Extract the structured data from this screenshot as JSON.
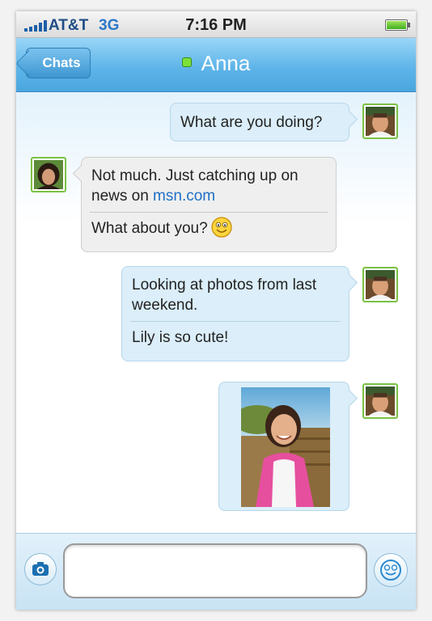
{
  "status_bar": {
    "carrier": "AT&T",
    "network": "3G",
    "time": "7:16 PM"
  },
  "nav": {
    "back_label": "Chats",
    "contact_name": "Anna",
    "presence": "online"
  },
  "messages": [
    {
      "sender": "me",
      "lines": [
        "What are you doing?"
      ]
    },
    {
      "sender": "Anna",
      "text_before_link": "Not much. Just catching up on news on ",
      "link": "msn.com",
      "followup": "What about you?"
    },
    {
      "sender": "me",
      "lines": [
        "Looking at photos from last weekend.",
        "Lily is so cute!"
      ]
    },
    {
      "sender": "me",
      "attachment": "photo"
    }
  ],
  "composer": {
    "message_value": "",
    "camera_icon": "camera-icon",
    "emoticon_icon": "emoticon-icon"
  },
  "colors": {
    "nav_blue": "#5fb5e9",
    "presence_green": "#7be13a",
    "link_blue": "#1f6fc6"
  }
}
